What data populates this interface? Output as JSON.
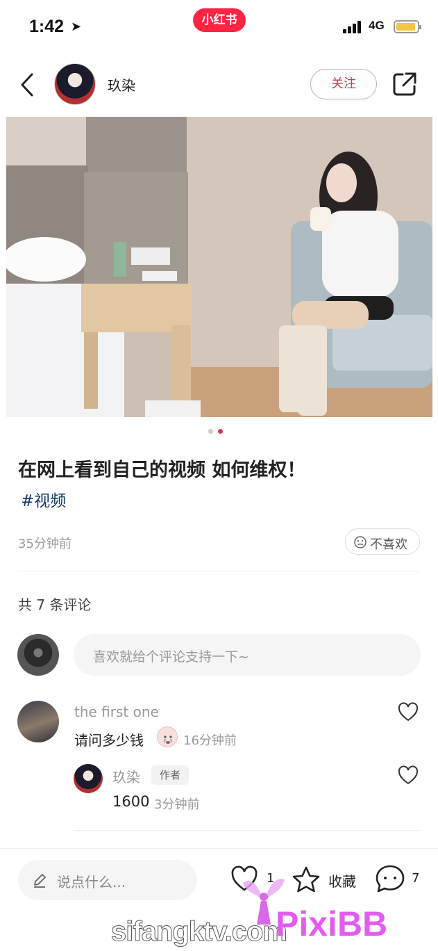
{
  "status_bar": {
    "time": "1:42",
    "location_glyph": "➤",
    "app_badge": "小红书",
    "network": "4G"
  },
  "header": {
    "author_name": "玖染",
    "follow_label": "关注"
  },
  "note": {
    "title": "在网上看到自己的视频 如何维权！",
    "tag": "#视频",
    "time": "35分钟前",
    "dislike_label": "不喜欢",
    "image_index": 2,
    "image_count": 2
  },
  "comments": {
    "count_label": "共 7 条评论",
    "input_placeholder": "喜欢就给个评论支持一下~",
    "items": [
      {
        "user": "the first one",
        "text": "请问多少钱",
        "time": "16分钟前"
      }
    ],
    "reply": {
      "user": "玖染",
      "badge": "作者",
      "text": "1600",
      "time": "3分钟前"
    }
  },
  "bottom_bar": {
    "input_placeholder": "说点什么...",
    "like_count": "1",
    "collect_label": "收藏",
    "comment_count": "7"
  },
  "watermarks": {
    "site": "sifangktv.com",
    "brand": "PixiBB"
  },
  "colors": {
    "brand_red": "#ff2442",
    "tag_blue": "#13386c"
  }
}
